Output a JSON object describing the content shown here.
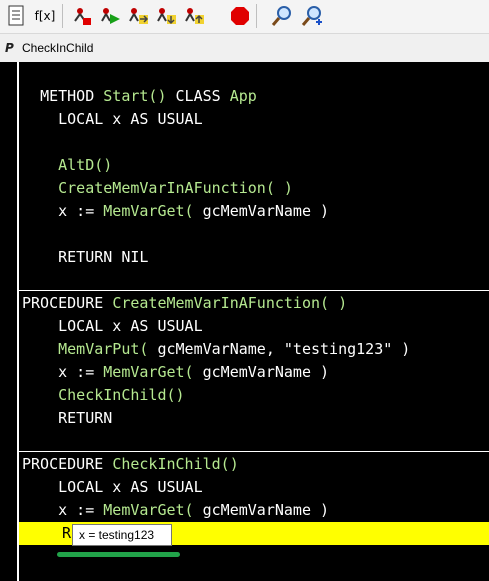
{
  "toolbar": {
    "buttons": [
      {
        "icon": "document-list-icon"
      },
      {
        "icon": "fx-icon",
        "label": "f[x]"
      },
      {
        "icon": "stop-here-icon"
      },
      {
        "icon": "run-to-cursor-icon"
      },
      {
        "icon": "step-over-icon"
      },
      {
        "icon": "step-into-icon"
      },
      {
        "icon": "step-out-icon"
      },
      {
        "icon": "stop-icon"
      },
      {
        "icon": "zoom-search-icon"
      },
      {
        "icon": "add-watch-icon"
      }
    ]
  },
  "tab": {
    "title": "CheckInChild",
    "icon": "procedure-icon"
  },
  "code": {
    "l1": {
      "a": "METHOD ",
      "b": "Start()",
      "c": " CLASS ",
      "d": "App"
    },
    "l2": {
      "a": "    LOCAL x AS USUAL"
    },
    "l3": {
      "a": "    AltD()"
    },
    "l4": {
      "a": "    CreateMemVarInAFunction( )"
    },
    "l5": {
      "a": "    x := ",
      "b": "MemVarGet(",
      "c": " gcMemVarName )"
    },
    "l6": {
      "a": "    RETURN NIL"
    },
    "l7": {
      "a": "PROCEDURE ",
      "b": "CreateMemVarInAFunction( )"
    },
    "l8": {
      "a": "    LOCAL x AS USUAL"
    },
    "l9": {
      "a": "    MemVarPut(",
      "b": " gcMemVarName, ",
      "c": "\"testing123\"",
      "d": " )"
    },
    "l10": {
      "a": "    x := ",
      "b": "MemVarGet(",
      "c": " gcMemVarName )"
    },
    "l11": {
      "a": "    CheckInChild()"
    },
    "l12": {
      "a": "    RETURN"
    },
    "l13": {
      "a": "PROCEDURE ",
      "b": "CheckInChild()"
    },
    "l14": {
      "a": "    LOCAL x AS USUAL"
    },
    "l15": {
      "a": "    x := ",
      "b": "MemVarGet(",
      "c": " gcMemVarName )"
    },
    "l16": {
      "a": "R"
    }
  },
  "tooltip": {
    "text": "x = testing123"
  },
  "colors": {
    "background": "#000000",
    "keyword": "#ffffff",
    "function": "#b5e890",
    "current_line": "#ffff00",
    "underline": "#22a34a"
  }
}
